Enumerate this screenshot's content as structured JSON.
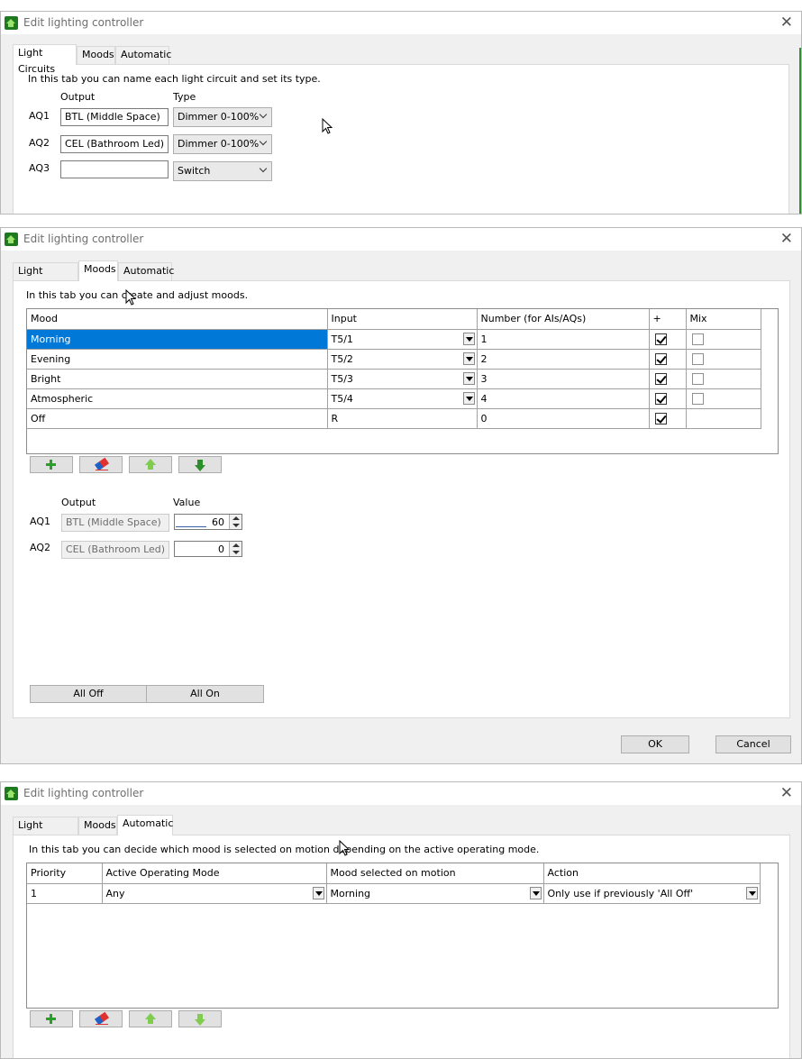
{
  "dialog_title": "Edit lighting controller",
  "tabs": [
    "Light Circuits",
    "Moods",
    "Automatic"
  ],
  "light_circuits": {
    "description": "In this tab you can name each light circuit and set its type.",
    "output_header": "Output",
    "type_header": "Type",
    "rows": [
      {
        "id": "AQ1",
        "output": "BTL (Middle Space)",
        "type": "Dimmer 0-100%"
      },
      {
        "id": "AQ2",
        "output": "CEL (Bathroom Led)",
        "type": "Dimmer 0-100%"
      },
      {
        "id": "AQ3",
        "output": "",
        "type": "Switch"
      }
    ]
  },
  "moods": {
    "description": "In this tab you can create and adjust moods.",
    "columns": [
      "Mood",
      "Input",
      "Number (for AIs/AQs)",
      "+",
      "Mix"
    ],
    "rows": [
      {
        "mood": "Morning",
        "input": "T5/1",
        "number": "1",
        "plus": true,
        "mix": false,
        "selected": true
      },
      {
        "mood": "Evening",
        "input": "T5/2",
        "number": "2",
        "plus": true,
        "mix": false
      },
      {
        "mood": "Bright",
        "input": "T5/3",
        "number": "3",
        "plus": true,
        "mix": false
      },
      {
        "mood": "Atmospheric",
        "input": "T5/4",
        "number": "4",
        "plus": true,
        "mix": false
      },
      {
        "mood": "Off",
        "input": "R",
        "number": "0",
        "plus": true,
        "mix": null
      }
    ],
    "output_header": "Output",
    "value_header": "Value",
    "values": [
      {
        "id": "AQ1",
        "output": "BTL (Middle Space)",
        "value": "60",
        "level": 0.6
      },
      {
        "id": "AQ2",
        "output": "CEL (Bathroom Led)",
        "value": "0",
        "level": 0
      }
    ],
    "all_off_label": "All Off",
    "all_on_label": "All On"
  },
  "automatic": {
    "description": "In this tab you can decide which mood is selected on motion depending on the active operating mode.",
    "columns": [
      "Priority",
      "Active Operating Mode",
      "Mood selected on motion",
      "Action"
    ],
    "rows": [
      {
        "priority": "1",
        "mode": "Any",
        "mood": "Morning",
        "action": "Only use if previously 'All Off'"
      }
    ]
  },
  "footer": {
    "ok_label": "OK",
    "cancel_label": "Cancel"
  },
  "icons": {
    "app": "lighting-controller-app-icon",
    "close": "close-icon",
    "add": "plus-icon",
    "delete": "eraser-icon",
    "up": "arrow-up-icon",
    "down": "arrow-down-icon"
  },
  "colors": {
    "selection": "#0078d7",
    "accent_green": "#2aa02a"
  }
}
